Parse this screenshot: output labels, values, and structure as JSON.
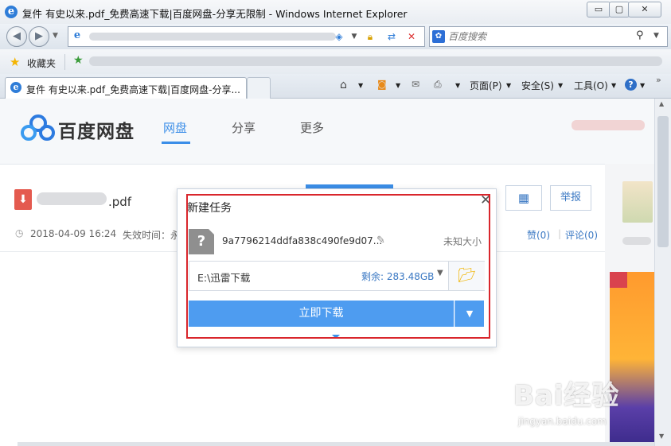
{
  "window": {
    "title": "复件 有史以来.pdf_免费高速下载|百度网盘-分享无限制 - Windows Internet Explorer",
    "controls": [
      "▭",
      "▢",
      "✕"
    ]
  },
  "address_bar": {
    "site_icon": "e"
  },
  "search_bar": {
    "placeholder": "百度搜索"
  },
  "favorites": {
    "label": "收藏夹"
  },
  "tabs": [
    {
      "label": "复件 有史以来.pdf_免费高速下载|百度网盘-分享..."
    }
  ],
  "toolbar": {
    "page_menu": "页面(P)",
    "safety_menu": "安全(S)",
    "tools_menu": "工具(O)"
  },
  "pan": {
    "logo_text": "百度网盘",
    "nav": [
      "网盘",
      "分享",
      "更多"
    ],
    "active_nav": "网盘"
  },
  "file": {
    "name_ext": ".pdf",
    "date": "2018-04-09 16:24",
    "expire_label": "失效时间：永",
    "report": "举报",
    "like": "赞(0)",
    "comment": "评论(0)"
  },
  "dialog": {
    "title": "新建任务",
    "filename": "9a7796214ddfa838c490fe9d07...",
    "size": "未知大小",
    "path": "E:\\迅雷下载",
    "free_space": "剩余: 283.48GB",
    "download_button": "立即下载"
  },
  "watermark": {
    "main": "Bai经验",
    "sub": "jingyan.baidu.com"
  },
  "colors": {
    "accent": "#3b8ee8",
    "highlight": "#d9262c",
    "download": "#4e9cf0"
  }
}
